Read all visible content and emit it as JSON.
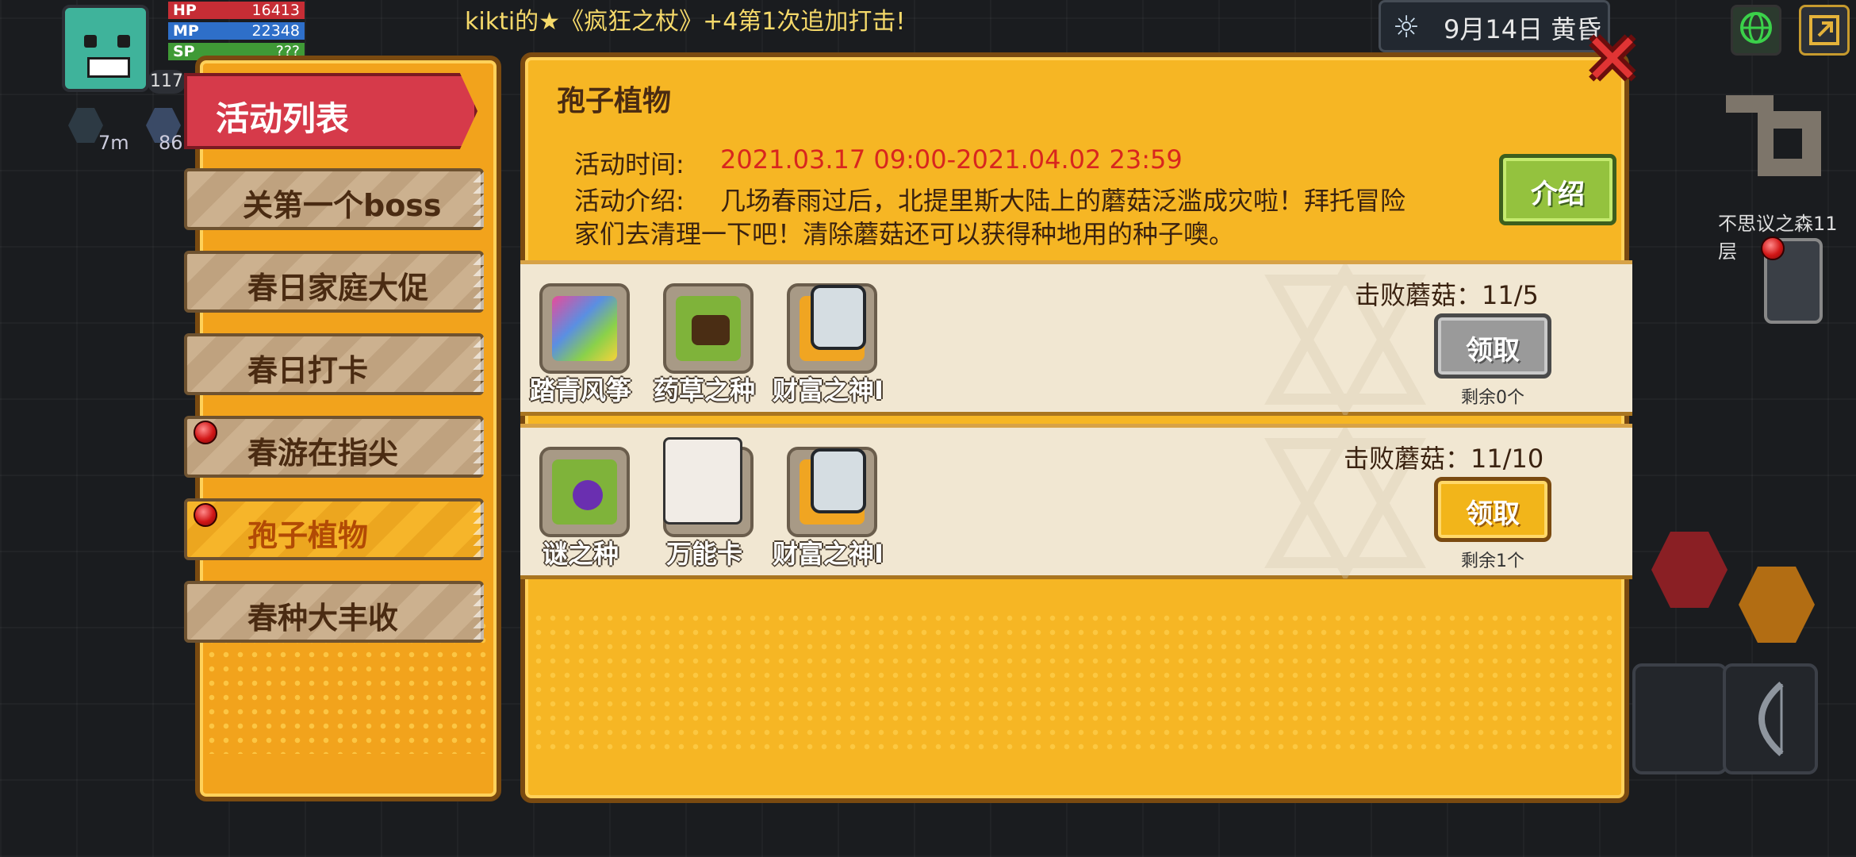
{
  "hud": {
    "hp_label": "HP",
    "hp_value": "16413",
    "mp_label": "MP",
    "mp_value": "22348",
    "sp_label": "SP",
    "sp_value": "???",
    "level": "117",
    "buff1": "7m",
    "buff2": "86",
    "ticker": "kikti的★《疯狂之杖》+4第1次追加打击!",
    "date": "9月14日 黄昏",
    "map_label": "不思议之森11层"
  },
  "menu": {
    "header": "活动列表",
    "tabs": [
      {
        "label": "关第一个boss",
        "dot": false,
        "selected": false
      },
      {
        "label": "春日家庭大促",
        "dot": false,
        "selected": false
      },
      {
        "label": "春日打卡",
        "dot": false,
        "selected": false
      },
      {
        "label": "春游在指尖",
        "dot": true,
        "selected": false
      },
      {
        "label": "孢子植物",
        "dot": true,
        "selected": true
      },
      {
        "label": "春种大丰收",
        "dot": false,
        "selected": false
      }
    ]
  },
  "event": {
    "title": "孢子植物",
    "time_label": "活动时间:",
    "time_value": "2021.03.17 09:00-2021.04.02 23:59",
    "intro_label": "活动介绍:",
    "intro_line1": "几场春雨过后，北提里斯大陆上的蘑菇泛滥成灾啦！拜托冒险",
    "intro_line2": "家们去清理一下吧！清除蘑菇还可以获得种地用的种子噢。",
    "intro_button": "介绍"
  },
  "rewards": [
    {
      "goal": "击败蘑菇：11/5",
      "items": [
        "踏青风筝",
        "药草之种",
        "财富之神I"
      ],
      "claim_label": "领取",
      "claim_enabled": false,
      "remaining": "剩余0个"
    },
    {
      "goal": "击败蘑菇：11/10",
      "items": [
        "谜之种",
        "万能卡",
        "财富之神I"
      ],
      "claim_label": "领取",
      "claim_enabled": true,
      "remaining": "剩余1个"
    }
  ],
  "colors": {
    "panel": "#f6b624",
    "header_red": "#d63a4a",
    "time_red": "#d8261e",
    "intro_green": "#94c23e"
  }
}
